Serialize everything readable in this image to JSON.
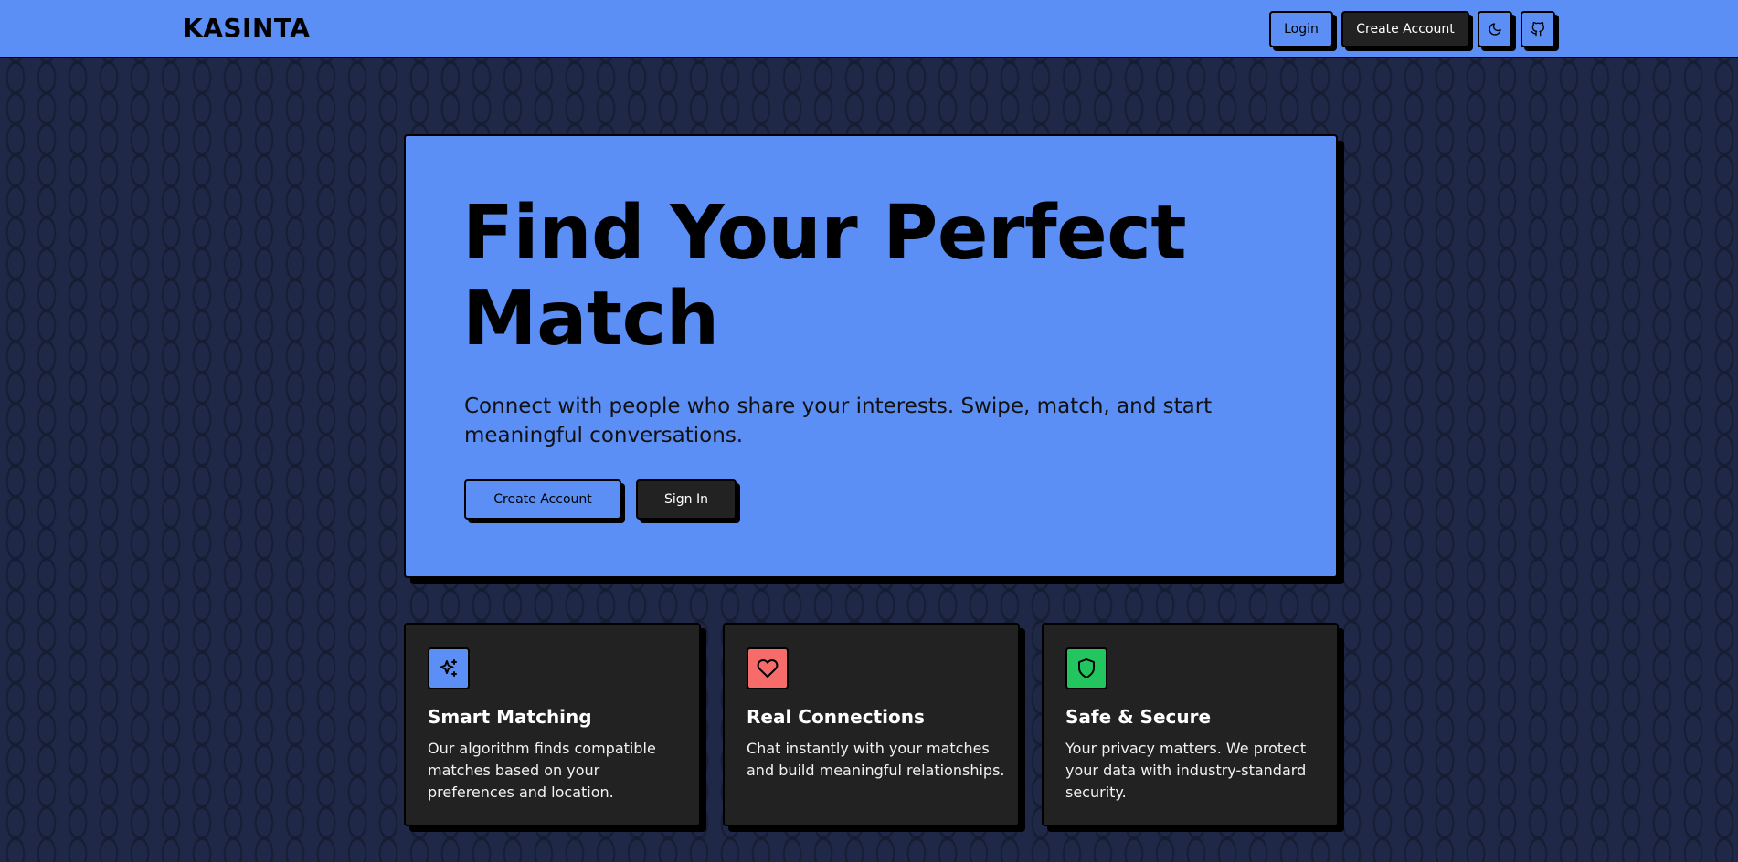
{
  "header": {
    "logo": "KASINTA",
    "login_label": "Login",
    "create_account_label": "Create Account",
    "theme_icon": "moon-icon",
    "github_icon": "github-icon"
  },
  "hero": {
    "title": "Find Your Perfect Match",
    "subtitle": "Connect with people who share your interests. Swipe, match, and start meaningful conversations.",
    "create_account_label": "Create Account",
    "sign_in_label": "Sign In"
  },
  "features": [
    {
      "icon": "sparkles-icon",
      "color": "#5b8ff5",
      "title": "Smart Matching",
      "description": "Our algorithm finds compatible matches based on your preferences and location."
    },
    {
      "icon": "heart-icon",
      "color": "#f86b6b",
      "title": "Real Connections",
      "description": "Chat instantly with your matches and build meaningful relationships."
    },
    {
      "icon": "shield-icon",
      "color": "#22c55e",
      "title": "Safe & Secure",
      "description": "Your privacy matters. We protect your data with industry-standard security."
    }
  ],
  "colors": {
    "accent": "#5b8ff5",
    "background": "#1f2847",
    "card": "#222222"
  }
}
